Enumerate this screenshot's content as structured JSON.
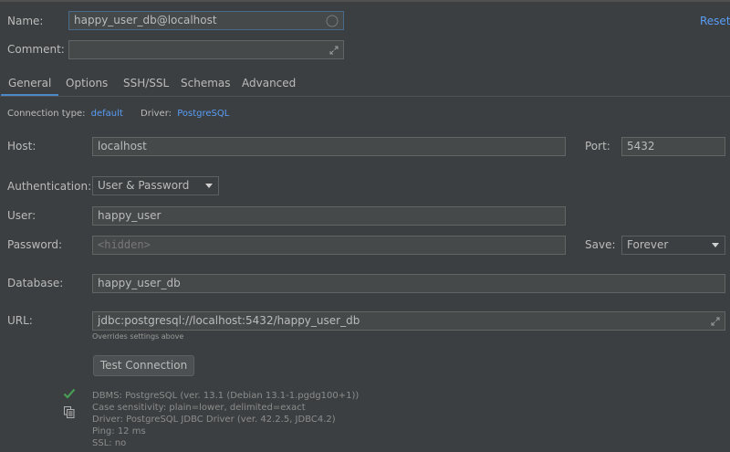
{
  "header": {
    "name_label": "Name:",
    "name_value": "happy_user_db@localhost",
    "comment_label": "Comment:",
    "comment_value": "",
    "reset_label": "Reset"
  },
  "tabs": [
    {
      "label": "General",
      "active": true
    },
    {
      "label": "Options",
      "active": false
    },
    {
      "label": "SSH/SSL",
      "active": false
    },
    {
      "label": "Schemas",
      "active": false
    },
    {
      "label": "Advanced",
      "active": false
    }
  ],
  "connection": {
    "type_label": "Connection type:",
    "type_value": "default",
    "driver_label": "Driver:",
    "driver_value": "PostgreSQL"
  },
  "form": {
    "host_label": "Host:",
    "host_value": "localhost",
    "port_label": "Port:",
    "port_value": "5432",
    "auth_label": "Authentication:",
    "auth_value": "User & Password",
    "user_label": "User:",
    "user_value": "happy_user",
    "password_label": "Password:",
    "password_placeholder": "<hidden>",
    "save_label": "Save:",
    "save_value": "Forever",
    "database_label": "Database:",
    "database_value": "happy_user_db",
    "url_label": "URL:",
    "url_value": "jdbc:postgresql://localhost:5432/happy_user_db",
    "url_note": "Overrides settings above"
  },
  "test_button_label": "Test Connection",
  "test_result": {
    "dbms": "DBMS: PostgreSQL (ver. 13.1 (Debian 13.1-1.pgdg100+1))",
    "case": "Case sensitivity: plain=lower, delimited=exact",
    "driver": "Driver: PostgreSQL JDBC Driver (ver. 42.2.5, JDBC4.2)",
    "ping": "Ping: 12 ms",
    "ssl": "SSL: no"
  },
  "colors": {
    "background": "#3c3f41",
    "link": "#589df6",
    "success": "#499c54",
    "tab_underline": "#4a88c7"
  }
}
